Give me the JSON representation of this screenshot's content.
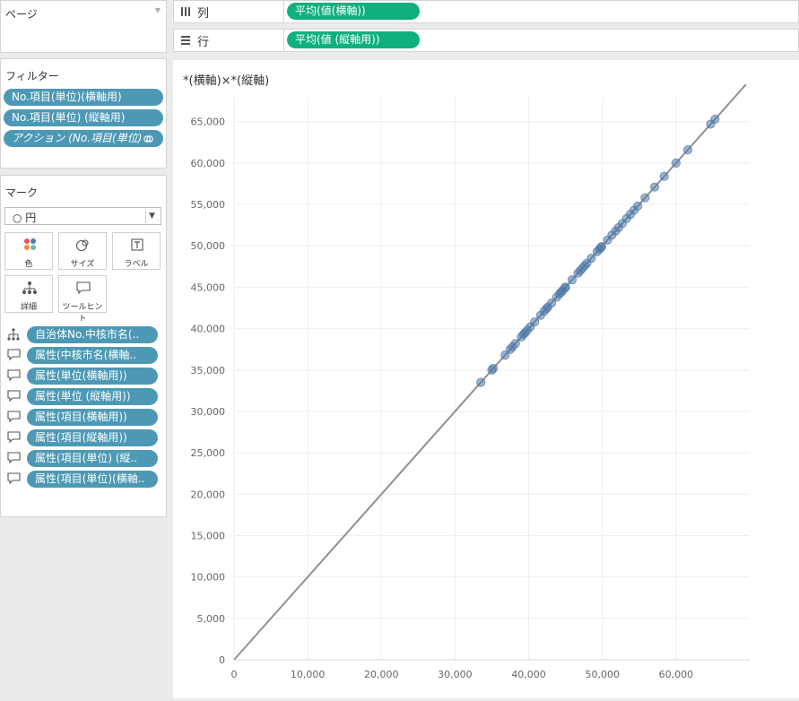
{
  "page_shelf": {
    "label": "ページ"
  },
  "filters": {
    "title": "フィルター",
    "items": [
      "No.項目(単位)(横軸用)",
      "No.項目(単位) (縦軸用)",
      "アクション (No.項目(単位) .."
    ]
  },
  "marks": {
    "title": "マーク",
    "type_label": "○ 円",
    "buttons": {
      "color": "色",
      "size": "サイズ",
      "label": "ラベル",
      "detail": "詳細",
      "tooltip": "ツールヒント"
    },
    "fields": [
      "自治体No.中核市名(..",
      "属性(中核市名(横軸..",
      "属性(単位(横軸用))",
      "属性(単位 (縦軸用))",
      "属性(項目(横軸用))",
      "属性(項目(縦軸用))",
      "属性(項目(単位) (縦..",
      "属性(項目(単位)(横軸.."
    ]
  },
  "columns_shelf": {
    "label": "列",
    "pill": "平均(値(横軸))"
  },
  "rows_shelf": {
    "label": "行",
    "pill": "平均(値 (縦軸用))"
  },
  "colors": {
    "pill_teal": "#4d99b5",
    "pill_green": "#0fb07e",
    "point": "#4e79a7",
    "line": "#909090"
  },
  "chart_data": {
    "type": "scatter",
    "title": "*(横軸)×*(縦軸)",
    "xlabel": "",
    "ylabel": "",
    "xlim": [
      0,
      70000
    ],
    "ylim": [
      0,
      68000
    ],
    "x_ticks": [
      "0",
      "10,000",
      "20,000",
      "30,000",
      "40,000",
      "50,000",
      "60,000"
    ],
    "x_tick_values": [
      0,
      10000,
      20000,
      30000,
      40000,
      50000,
      60000
    ],
    "y_ticks": [
      "0",
      "5,000",
      "10,000",
      "15,000",
      "20,000",
      "25,000",
      "30,000",
      "35,000",
      "40,000",
      "45,000",
      "50,000",
      "55,000",
      "60,000",
      "65,000"
    ],
    "y_tick_values": [
      0,
      5000,
      10000,
      15000,
      20000,
      25000,
      30000,
      35000,
      40000,
      45000,
      50000,
      55000,
      60000,
      65000
    ],
    "trend_line": {
      "x": [
        0,
        69500
      ],
      "y": [
        0,
        69500
      ]
    },
    "points": {
      "x": [
        33500,
        35000,
        35200,
        36800,
        37500,
        37800,
        38200,
        39000,
        39300,
        39500,
        39800,
        40200,
        40800,
        41600,
        42100,
        42400,
        42600,
        43100,
        43800,
        44200,
        44400,
        44600,
        44900,
        45000,
        45900,
        46700,
        47000,
        47300,
        47600,
        47900,
        48500,
        49300,
        49600,
        49800,
        49900,
        50700,
        51300,
        51800,
        52200,
        52700,
        53300,
        53800,
        54300,
        54800,
        55800,
        57100,
        58400,
        60000,
        61600,
        64700,
        65300
      ],
      "y": [
        33500,
        35000,
        35200,
        36800,
        37500,
        37800,
        38200,
        39000,
        39300,
        39500,
        39800,
        40200,
        40800,
        41600,
        42100,
        42400,
        42600,
        43100,
        43800,
        44200,
        44400,
        44600,
        44900,
        45000,
        45900,
        46700,
        47000,
        47300,
        47600,
        47900,
        48500,
        49300,
        49600,
        49800,
        49900,
        50700,
        51300,
        51800,
        52200,
        52700,
        53300,
        53800,
        54300,
        54800,
        55800,
        57100,
        58400,
        60000,
        61600,
        64700,
        65300
      ]
    },
    "grid": true
  }
}
